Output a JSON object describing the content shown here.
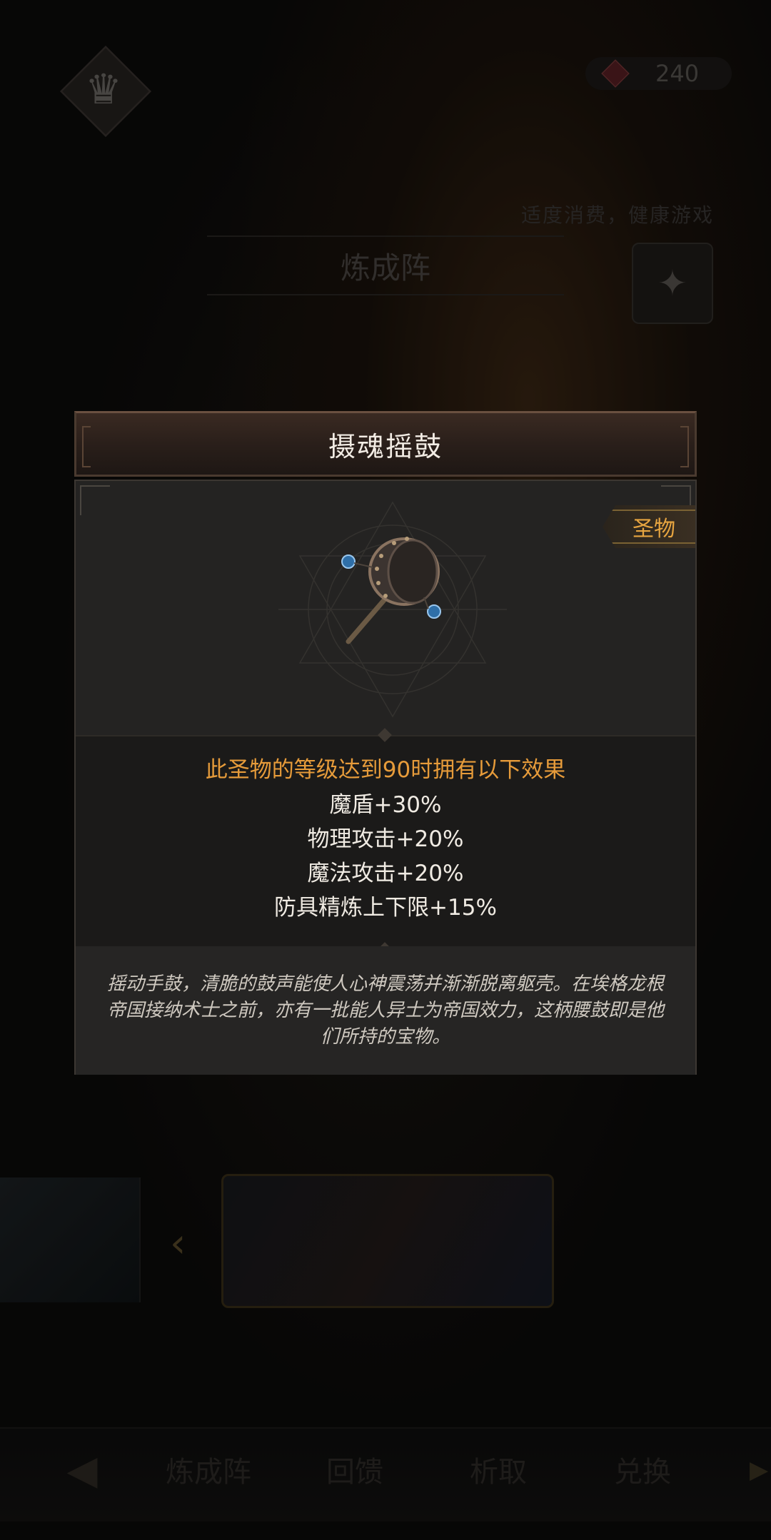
{
  "topbar": {
    "currency_value": "240",
    "notice": "适度消费，健康游戏"
  },
  "background": {
    "title": "炼成阵"
  },
  "bottom_nav": {
    "items": [
      "炼成阵",
      "回馈",
      "析取",
      "兑换"
    ]
  },
  "modal": {
    "title": "摄魂摇鼓",
    "rarity": "圣物",
    "effects_heading": "此圣物的等级达到90时拥有以下效果",
    "effects": [
      "魔盾+30%",
      "物理攻击+20%",
      "魔法攻击+20%",
      "防具精炼上下限+15%"
    ],
    "description": "摇动手鼓，清脆的鼓声能使人心神震荡并渐渐脱离躯壳。在埃格龙根帝国接纳术士之前，亦有一批能人异士为帝国效力，这柄腰鼓即是他们所持的宝物。"
  },
  "colors": {
    "rarity_accent": "#e7a540",
    "heading_accent": "#e69b3a",
    "panel_bg": "#242322"
  }
}
